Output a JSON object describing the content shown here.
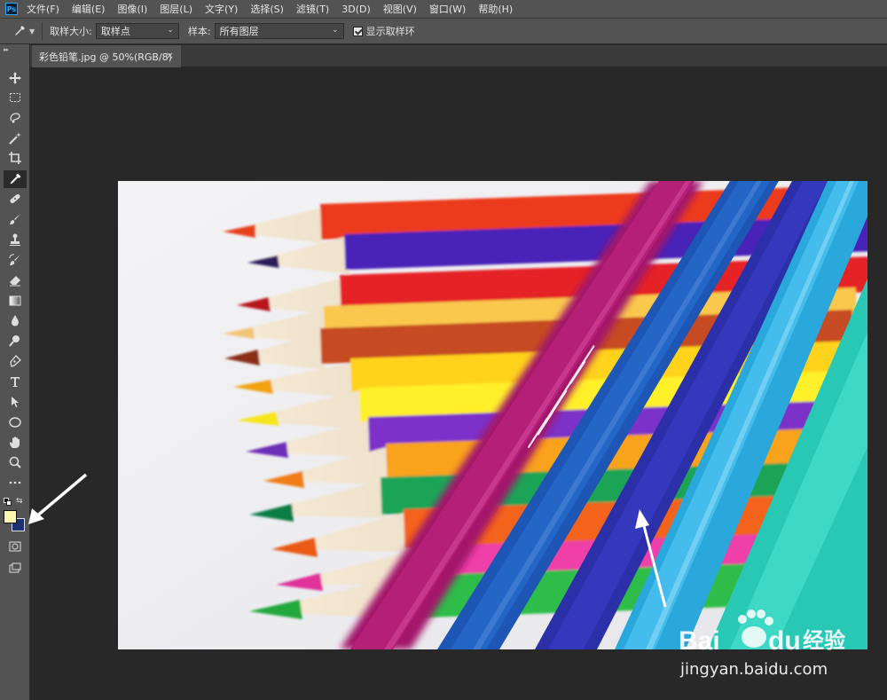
{
  "app": {
    "logo": "Ps"
  },
  "menu": [
    "文件(F)",
    "编辑(E)",
    "图像(I)",
    "图层(L)",
    "文字(Y)",
    "选择(S)",
    "滤镜(T)",
    "3D(D)",
    "视图(V)",
    "窗口(W)",
    "帮助(H)"
  ],
  "options": {
    "sample_size_label": "取样大小:",
    "sample_size_value": "取样点",
    "sample_label": "样本:",
    "sample_value": "所有图层",
    "show_ring_label": "显示取样环",
    "show_ring_checked": true
  },
  "document": {
    "tab_title": "彩色铅笔.jpg @ 50%(RGB/8)",
    "close_glyph": "×"
  },
  "colors": {
    "foreground": "#fff4b0",
    "background": "#1c2f6e",
    "ui_bg": "#535353",
    "workspace_bg": "#282828"
  },
  "toolbar": {
    "active_tool": "eyedropper",
    "tools": [
      "move",
      "marquee",
      "lasso",
      "magic-wand",
      "crop",
      "eyedropper",
      "healing",
      "brush",
      "stamp",
      "history-brush",
      "eraser",
      "gradient",
      "blur",
      "dodge",
      "pen",
      "type",
      "path-select",
      "ellipse",
      "hand",
      "zoom",
      "more"
    ]
  },
  "watermark": {
    "brand": "Bai",
    "brand_suffix": "du",
    "product": "经验",
    "url": "jingyan.baidu.com"
  }
}
